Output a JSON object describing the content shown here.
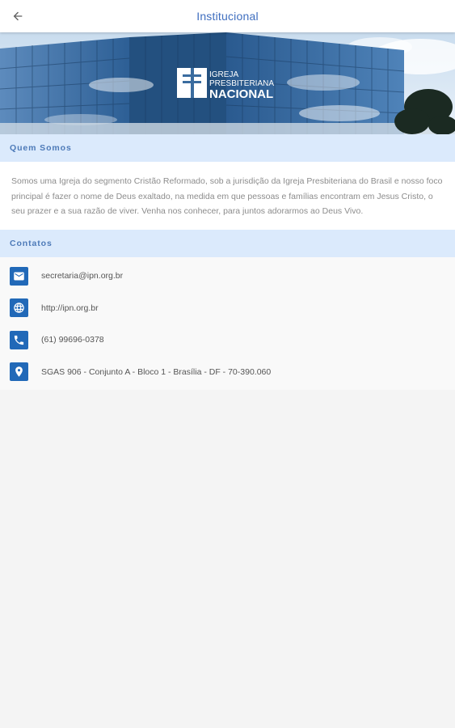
{
  "topbar": {
    "title": "Institucional",
    "back_icon": "arrow-left-icon"
  },
  "banner": {
    "logo_line1": "IGREJA",
    "logo_line2": "PRESBITERIANA",
    "logo_line3": "NACIONAL"
  },
  "about": {
    "header": "Quem Somos",
    "text": "Somos uma Igreja do segmento Cristão Reformado, sob a jurisdição da Igreja Presbiteriana do Brasil e nosso foco principal é fazer o nome de Deus exaltado, na medida em que pessoas e famílias encontram em Jesus Cristo, o seu prazer e a sua razão de viver. Venha nos conhecer, para juntos adorarmos ao Deus Vivo."
  },
  "contacts": {
    "header": "Contatos",
    "items": [
      {
        "icon": "email-icon",
        "text": "secretaria@ipn.org.br"
      },
      {
        "icon": "globe-icon",
        "text": "http://ipn.org.br"
      },
      {
        "icon": "phone-icon",
        "text": "(61) 99696-0378"
      },
      {
        "icon": "location-pin-icon",
        "text": "SGAS 906 - Conjunto A - Bloco 1 - Brasília - DF - 70-390.060"
      }
    ]
  },
  "colors": {
    "title": "#3f6ebf",
    "section_header_bg": "#dbeafc",
    "section_header_text": "#4d7ab8",
    "icon_bg": "#2169b8"
  }
}
